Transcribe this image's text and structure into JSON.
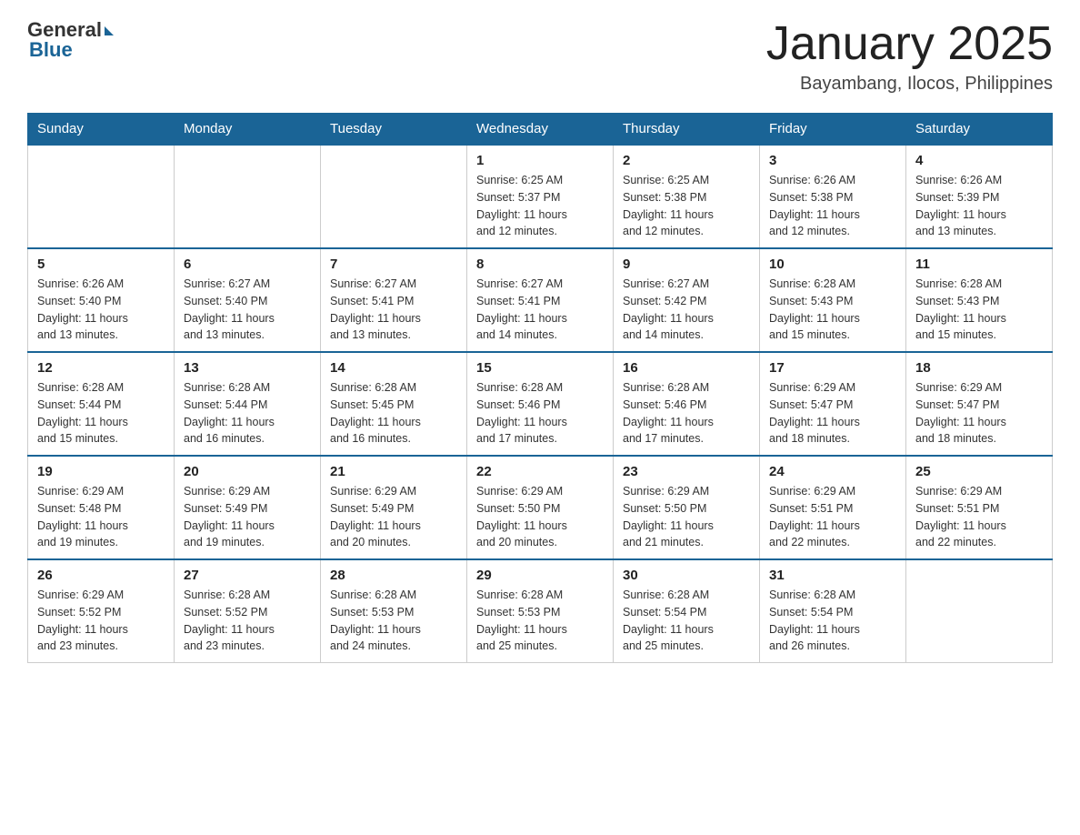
{
  "logo": {
    "general": "General",
    "arrow": "",
    "blue": "Blue"
  },
  "title": "January 2025",
  "location": "Bayambang, Ilocos, Philippines",
  "weekdays": [
    "Sunday",
    "Monday",
    "Tuesday",
    "Wednesday",
    "Thursday",
    "Friday",
    "Saturday"
  ],
  "weeks": [
    [
      {
        "day": "",
        "info": ""
      },
      {
        "day": "",
        "info": ""
      },
      {
        "day": "",
        "info": ""
      },
      {
        "day": "1",
        "info": "Sunrise: 6:25 AM\nSunset: 5:37 PM\nDaylight: 11 hours\nand 12 minutes."
      },
      {
        "day": "2",
        "info": "Sunrise: 6:25 AM\nSunset: 5:38 PM\nDaylight: 11 hours\nand 12 minutes."
      },
      {
        "day": "3",
        "info": "Sunrise: 6:26 AM\nSunset: 5:38 PM\nDaylight: 11 hours\nand 12 minutes."
      },
      {
        "day": "4",
        "info": "Sunrise: 6:26 AM\nSunset: 5:39 PM\nDaylight: 11 hours\nand 13 minutes."
      }
    ],
    [
      {
        "day": "5",
        "info": "Sunrise: 6:26 AM\nSunset: 5:40 PM\nDaylight: 11 hours\nand 13 minutes."
      },
      {
        "day": "6",
        "info": "Sunrise: 6:27 AM\nSunset: 5:40 PM\nDaylight: 11 hours\nand 13 minutes."
      },
      {
        "day": "7",
        "info": "Sunrise: 6:27 AM\nSunset: 5:41 PM\nDaylight: 11 hours\nand 13 minutes."
      },
      {
        "day": "8",
        "info": "Sunrise: 6:27 AM\nSunset: 5:41 PM\nDaylight: 11 hours\nand 14 minutes."
      },
      {
        "day": "9",
        "info": "Sunrise: 6:27 AM\nSunset: 5:42 PM\nDaylight: 11 hours\nand 14 minutes."
      },
      {
        "day": "10",
        "info": "Sunrise: 6:28 AM\nSunset: 5:43 PM\nDaylight: 11 hours\nand 15 minutes."
      },
      {
        "day": "11",
        "info": "Sunrise: 6:28 AM\nSunset: 5:43 PM\nDaylight: 11 hours\nand 15 minutes."
      }
    ],
    [
      {
        "day": "12",
        "info": "Sunrise: 6:28 AM\nSunset: 5:44 PM\nDaylight: 11 hours\nand 15 minutes."
      },
      {
        "day": "13",
        "info": "Sunrise: 6:28 AM\nSunset: 5:44 PM\nDaylight: 11 hours\nand 16 minutes."
      },
      {
        "day": "14",
        "info": "Sunrise: 6:28 AM\nSunset: 5:45 PM\nDaylight: 11 hours\nand 16 minutes."
      },
      {
        "day": "15",
        "info": "Sunrise: 6:28 AM\nSunset: 5:46 PM\nDaylight: 11 hours\nand 17 minutes."
      },
      {
        "day": "16",
        "info": "Sunrise: 6:28 AM\nSunset: 5:46 PM\nDaylight: 11 hours\nand 17 minutes."
      },
      {
        "day": "17",
        "info": "Sunrise: 6:29 AM\nSunset: 5:47 PM\nDaylight: 11 hours\nand 18 minutes."
      },
      {
        "day": "18",
        "info": "Sunrise: 6:29 AM\nSunset: 5:47 PM\nDaylight: 11 hours\nand 18 minutes."
      }
    ],
    [
      {
        "day": "19",
        "info": "Sunrise: 6:29 AM\nSunset: 5:48 PM\nDaylight: 11 hours\nand 19 minutes."
      },
      {
        "day": "20",
        "info": "Sunrise: 6:29 AM\nSunset: 5:49 PM\nDaylight: 11 hours\nand 19 minutes."
      },
      {
        "day": "21",
        "info": "Sunrise: 6:29 AM\nSunset: 5:49 PM\nDaylight: 11 hours\nand 20 minutes."
      },
      {
        "day": "22",
        "info": "Sunrise: 6:29 AM\nSunset: 5:50 PM\nDaylight: 11 hours\nand 20 minutes."
      },
      {
        "day": "23",
        "info": "Sunrise: 6:29 AM\nSunset: 5:50 PM\nDaylight: 11 hours\nand 21 minutes."
      },
      {
        "day": "24",
        "info": "Sunrise: 6:29 AM\nSunset: 5:51 PM\nDaylight: 11 hours\nand 22 minutes."
      },
      {
        "day": "25",
        "info": "Sunrise: 6:29 AM\nSunset: 5:51 PM\nDaylight: 11 hours\nand 22 minutes."
      }
    ],
    [
      {
        "day": "26",
        "info": "Sunrise: 6:29 AM\nSunset: 5:52 PM\nDaylight: 11 hours\nand 23 minutes."
      },
      {
        "day": "27",
        "info": "Sunrise: 6:28 AM\nSunset: 5:52 PM\nDaylight: 11 hours\nand 23 minutes."
      },
      {
        "day": "28",
        "info": "Sunrise: 6:28 AM\nSunset: 5:53 PM\nDaylight: 11 hours\nand 24 minutes."
      },
      {
        "day": "29",
        "info": "Sunrise: 6:28 AM\nSunset: 5:53 PM\nDaylight: 11 hours\nand 25 minutes."
      },
      {
        "day": "30",
        "info": "Sunrise: 6:28 AM\nSunset: 5:54 PM\nDaylight: 11 hours\nand 25 minutes."
      },
      {
        "day": "31",
        "info": "Sunrise: 6:28 AM\nSunset: 5:54 PM\nDaylight: 11 hours\nand 26 minutes."
      },
      {
        "day": "",
        "info": ""
      }
    ]
  ]
}
